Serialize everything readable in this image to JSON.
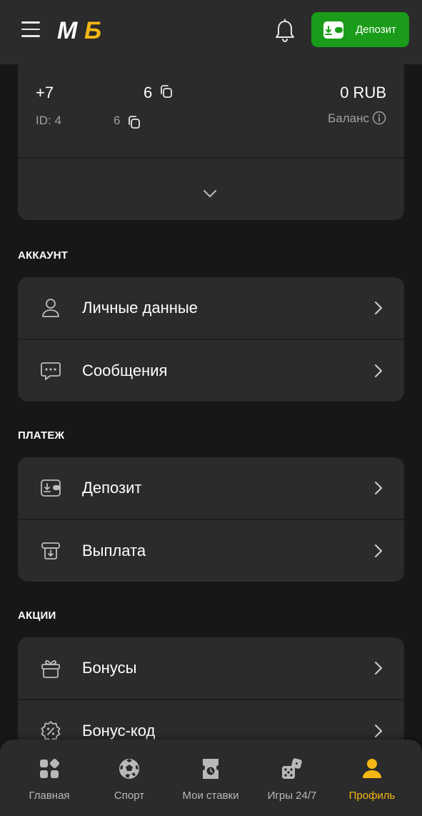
{
  "header": {
    "logo_text": "МБ",
    "deposit_label": "Депозит"
  },
  "account": {
    "phone_start": "+7",
    "phone_end": "6",
    "id_label": "ID: 4",
    "id_end": "6",
    "balance": "0 RUB",
    "balance_label": "Баланс"
  },
  "sections": {
    "account_title": "АККАУНТ",
    "account_items": [
      "Личные данные",
      "Сообщения"
    ],
    "payment_title": "ПЛАТЕЖ",
    "payment_items": [
      "Депозит",
      "Выплата"
    ],
    "promo_title": "АКЦИИ",
    "promo_items": [
      "Бонусы",
      "Бонус-код"
    ]
  },
  "nav": {
    "items": [
      "Главная",
      "Спорт",
      "Мои ставки",
      "Игры 24/7",
      "Профиль"
    ],
    "active": "Профиль"
  },
  "colors": {
    "accent_green": "#1a9c1a",
    "accent_yellow": "#f5b715",
    "card_bg": "#2b2b2b",
    "page_bg": "#171717"
  }
}
